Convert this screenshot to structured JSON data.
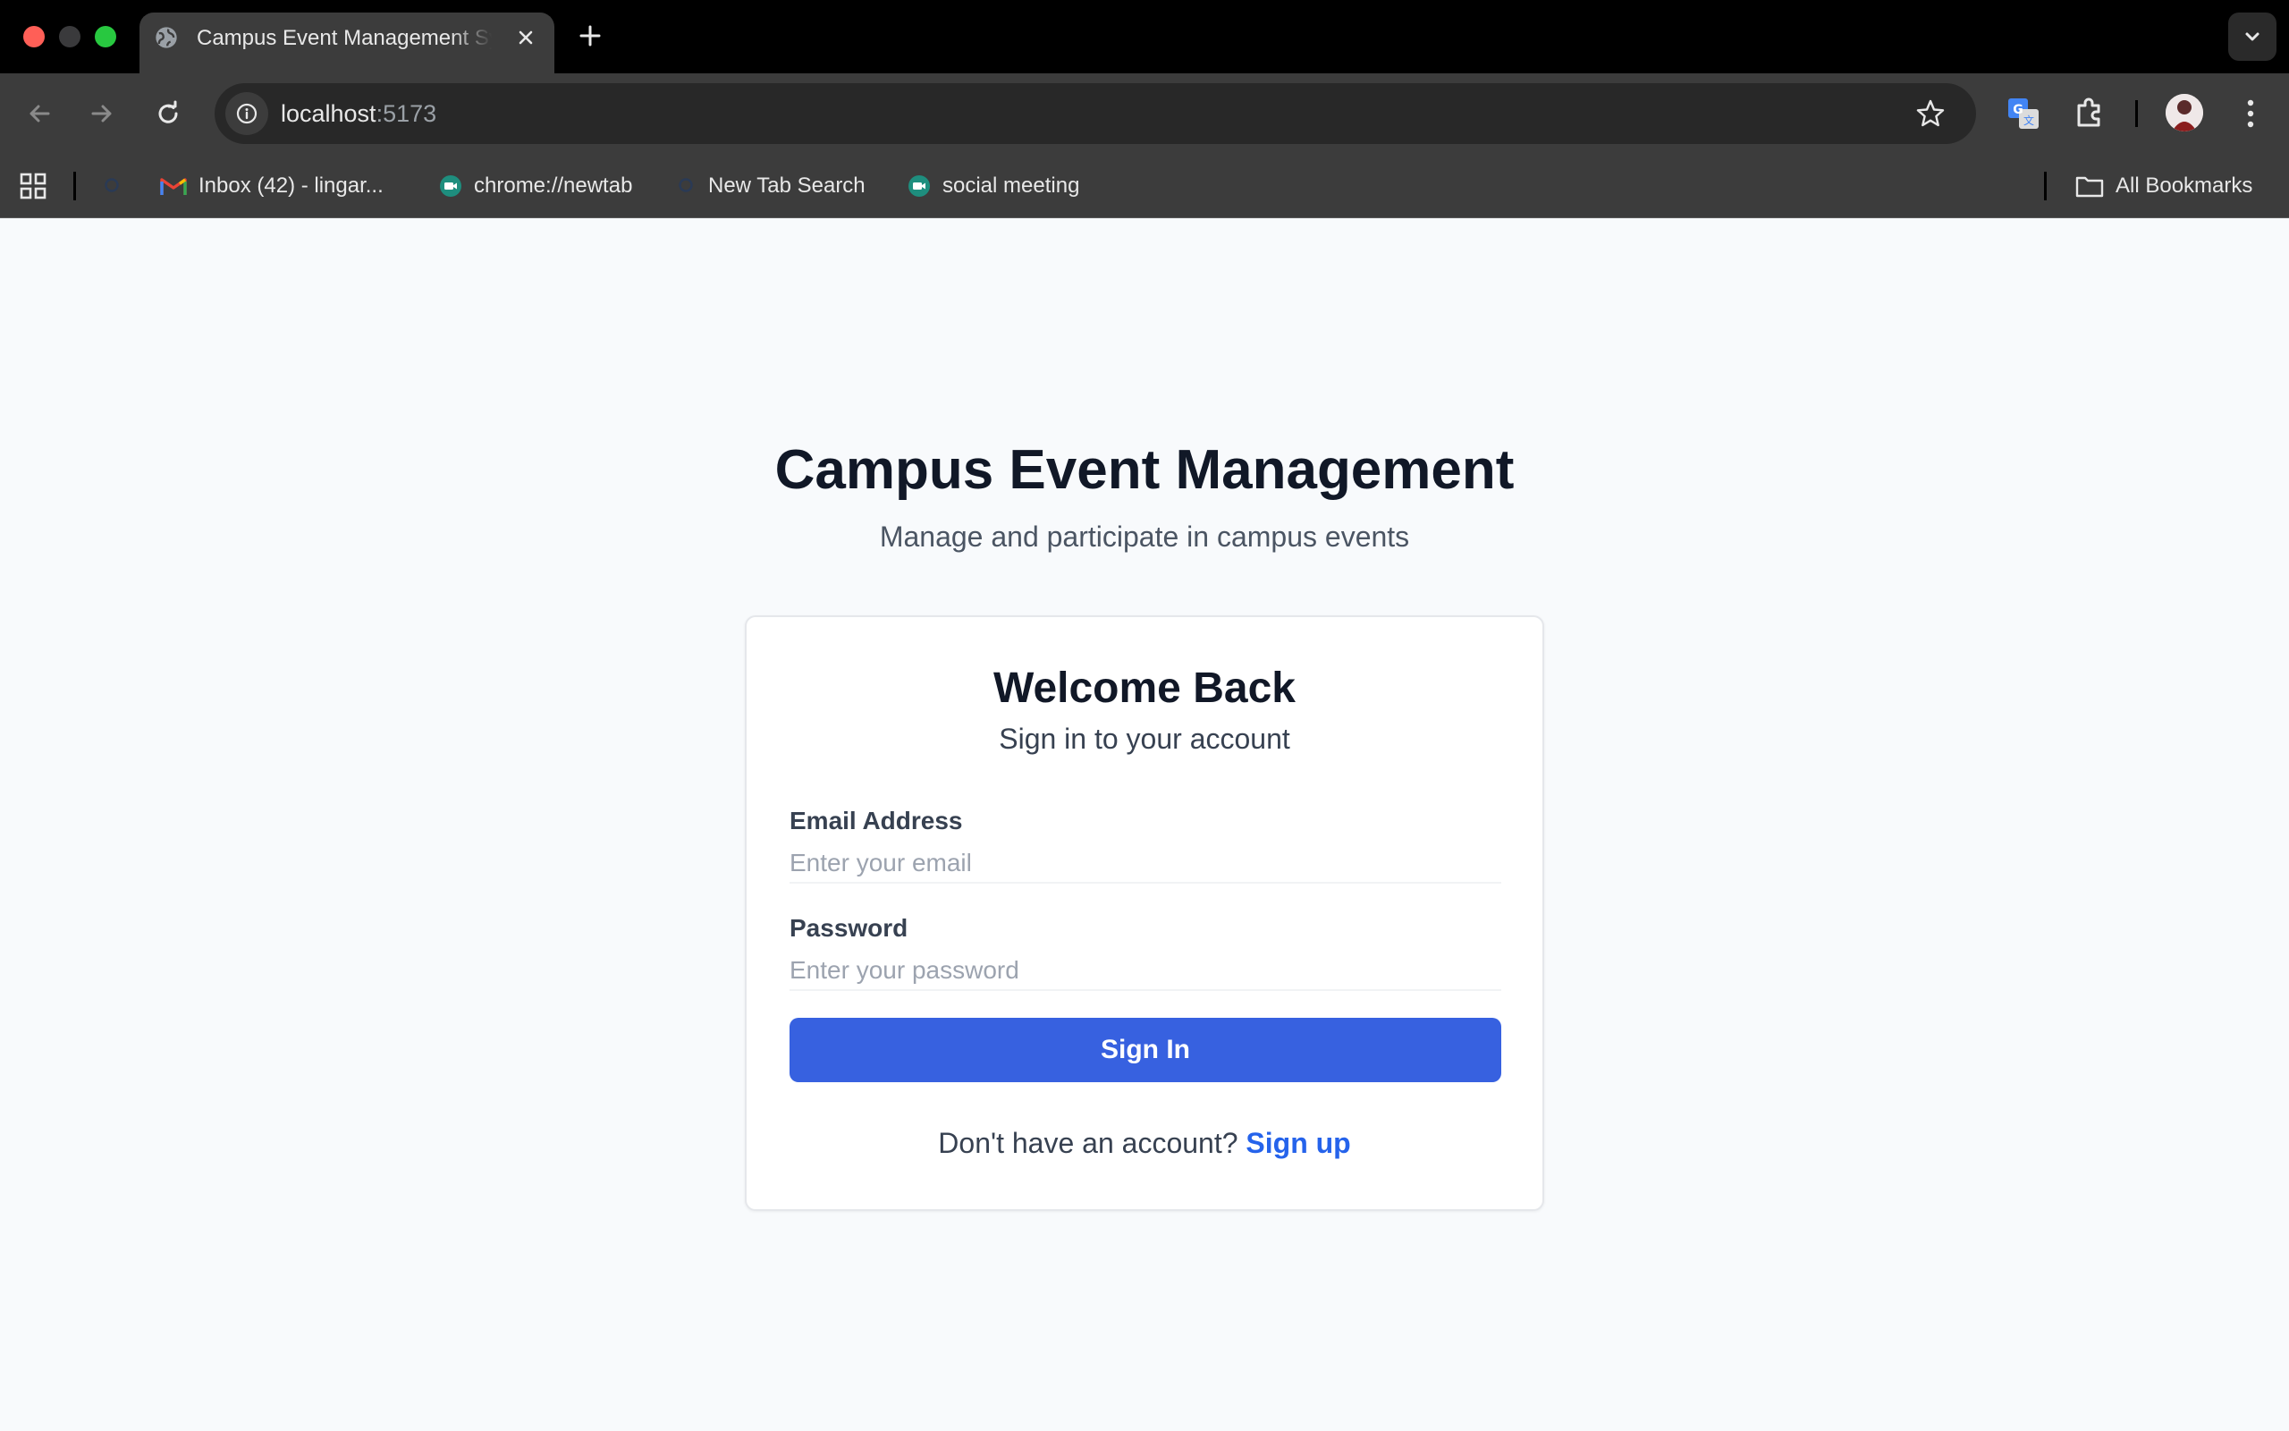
{
  "browser": {
    "tab": {
      "title": "Campus Event Management System",
      "favicon": "globe-icon"
    },
    "address_bar": {
      "host": "localhost",
      "port": ":5173"
    },
    "bookmarks": [
      {
        "label": "",
        "icon": "search-icon"
      },
      {
        "label": "Inbox (42) - lingar...",
        "icon": "gmail-icon"
      },
      {
        "label": "chrome://newtab",
        "icon": "meet-icon"
      },
      {
        "label": "New Tab Search",
        "icon": "search-icon"
      },
      {
        "label": "social meeting",
        "icon": "meet-icon"
      }
    ],
    "all_bookmarks_label": "All Bookmarks"
  },
  "page": {
    "title": "Campus Event Management",
    "subtitle": "Manage and participate in campus events"
  },
  "login": {
    "title": "Welcome Back",
    "subtitle": "Sign in to your account",
    "email": {
      "label": "Email Address",
      "placeholder": "Enter your email",
      "value": ""
    },
    "password": {
      "label": "Password",
      "placeholder": "Enter your password",
      "value": ""
    },
    "submit_label": "Sign In",
    "signup_prompt": "Don't have an account?",
    "signup_link": "Sign up"
  },
  "colors": {
    "primary": "#3761e0",
    "link": "#2563eb",
    "heading": "#111827",
    "page_background": "#f8fafc"
  }
}
